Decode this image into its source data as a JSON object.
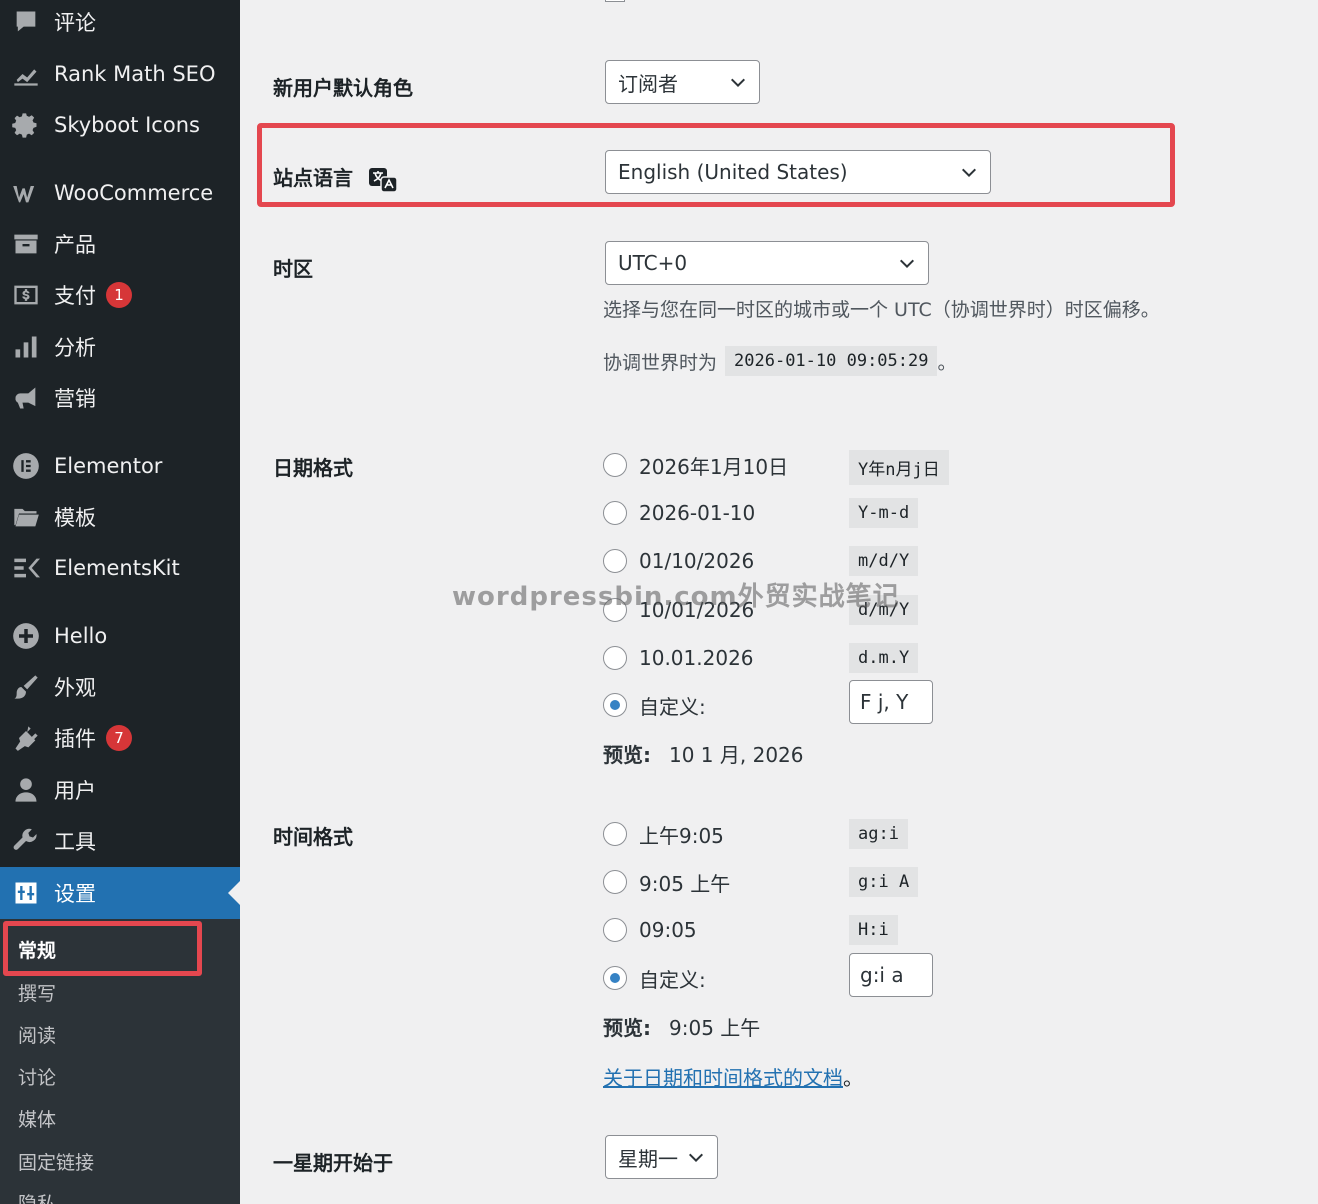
{
  "sidebar": {
    "items": [
      {
        "label": "评论",
        "icon": "comment-icon"
      },
      {
        "label": "Rank Math SEO",
        "icon": "rank-math-icon"
      },
      {
        "label": "Skyboot Icons",
        "icon": "gear-icon"
      },
      {
        "label": "WooCommerce",
        "icon": "woocommerce-icon"
      },
      {
        "label": "产品",
        "icon": "archive-icon"
      },
      {
        "label": "支付",
        "icon": "payment-icon",
        "badge": "1"
      },
      {
        "label": "分析",
        "icon": "bar-chart-icon"
      },
      {
        "label": "营销",
        "icon": "megaphone-icon"
      },
      {
        "label": "Elementor",
        "icon": "elementor-icon"
      },
      {
        "label": "模板",
        "icon": "folder-icon"
      },
      {
        "label": "ElementsKit",
        "icon": "elementskit-icon"
      },
      {
        "label": "Hello",
        "icon": "plus-circle-icon"
      },
      {
        "label": "外观",
        "icon": "paintbrush-icon"
      },
      {
        "label": "插件",
        "icon": "plugin-icon",
        "badge": "7"
      },
      {
        "label": "用户",
        "icon": "user-icon"
      },
      {
        "label": "工具",
        "icon": "wrench-icon"
      },
      {
        "label": "设置",
        "icon": "settings-icon"
      }
    ],
    "submenu": [
      "常规",
      "撰写",
      "阅读",
      "讨论",
      "媒体",
      "固定链接",
      "隐私"
    ]
  },
  "settings": {
    "default_role": {
      "label": "新用户默认角色",
      "value": "订阅者"
    },
    "site_language": {
      "label": "站点语言",
      "value": "English (United States)"
    },
    "timezone": {
      "label": "时区",
      "value": "UTC+0",
      "description": "选择与您在同一时区的城市或一个 UTC（协调世界时）时区偏移。",
      "utc_prefix": "协调世界时为",
      "utc_time": "2026-01-10 09:05:29",
      "utc_suffix": "。"
    },
    "date_format": {
      "label": "日期格式",
      "options": [
        {
          "text": "2026年1月10日",
          "code": "Y年n月j日"
        },
        {
          "text": "2026-01-10",
          "code": "Y-m-d"
        },
        {
          "text": "01/10/2026",
          "code": "m/d/Y"
        },
        {
          "text": "10/01/2026",
          "code": "d/m/Y"
        },
        {
          "text": "10.01.2026",
          "code": "d.m.Y"
        }
      ],
      "custom_label": "自定义:",
      "custom_value": "F j, Y",
      "preview_label": "预览:",
      "preview_value": "10 1 月, 2026"
    },
    "time_format": {
      "label": "时间格式",
      "options": [
        {
          "text": "上午9:05",
          "code": "ag:i"
        },
        {
          "text": "9:05 上午",
          "code": "g:i A"
        },
        {
          "text": "09:05",
          "code": "H:i"
        }
      ],
      "custom_label": "自定义:",
      "custom_value": "g:i a",
      "preview_label": "预览:",
      "preview_value": "9:05 上午"
    },
    "doc_link": {
      "text": "关于日期和时间格式的文档",
      "suffix": "。"
    },
    "week_start": {
      "label": "一星期开始于",
      "value": "星期一"
    }
  },
  "watermark": "wordpressbin.com外贸实战笔记",
  "colors": {
    "sidebar_bg": "#1d2327",
    "submenu_bg": "#2c3338",
    "accent": "#2271b1",
    "highlight_red": "#e4474f",
    "badge_red": "#d63638"
  }
}
